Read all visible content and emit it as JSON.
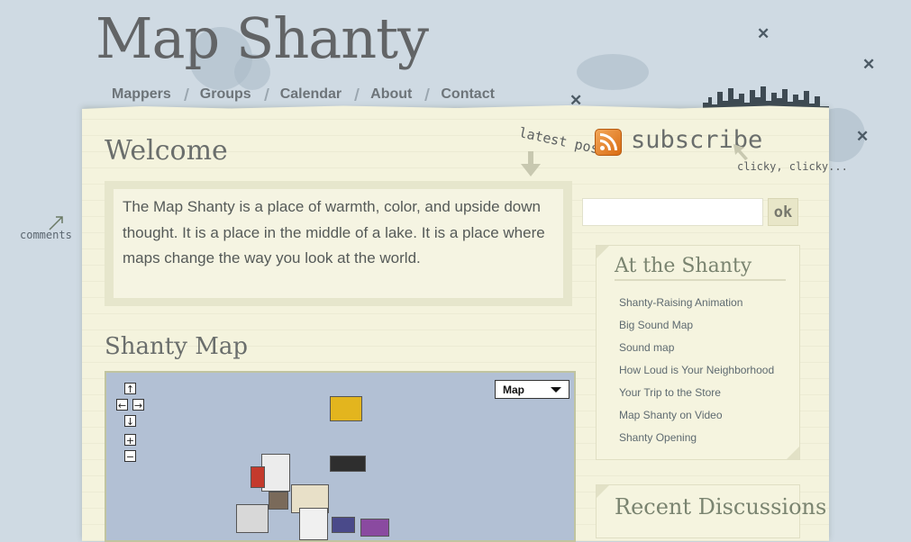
{
  "site": {
    "title": "Map Shanty"
  },
  "nav": {
    "items": [
      {
        "label": "Mappers"
      },
      {
        "label": "Groups"
      },
      {
        "label": "Calendar"
      },
      {
        "label": "About"
      },
      {
        "label": "Contact"
      }
    ]
  },
  "feed": {
    "latest_post": "latest post",
    "subscribe": "subscribe",
    "hint": "clicky, clicky...",
    "icon": "rss-icon"
  },
  "margin_note": {
    "comments": "comments"
  },
  "main": {
    "welcome_heading": "Welcome",
    "intro": "The Map Shanty is a place of warmth, color, and upside down thought. It is a place in the middle of a lake. It is a place where maps change the way you look at the world.",
    "map_heading": "Shanty Map",
    "map": {
      "type_selected": "Map",
      "controls": {
        "up": "↑",
        "left": "←",
        "right": "→",
        "down": "↓",
        "zoom_in": "+",
        "zoom_out": "−"
      }
    }
  },
  "sidebar": {
    "search": {
      "value": "",
      "button": "ok"
    },
    "at_the_shanty": {
      "heading": "At the Shanty",
      "links": [
        "Shanty-Raising Animation",
        "Big Sound Map",
        "Sound map",
        "How Loud is Your Neighborhood",
        "Your Trip to the Store",
        "Map Shanty on Video",
        "Shanty Opening"
      ]
    },
    "recent": {
      "heading": "Recent Discussions"
    }
  },
  "colors": {
    "background": "#cfdae3",
    "paper": "#f4f3dd",
    "title": "#626466",
    "link": "#5e6a70"
  }
}
